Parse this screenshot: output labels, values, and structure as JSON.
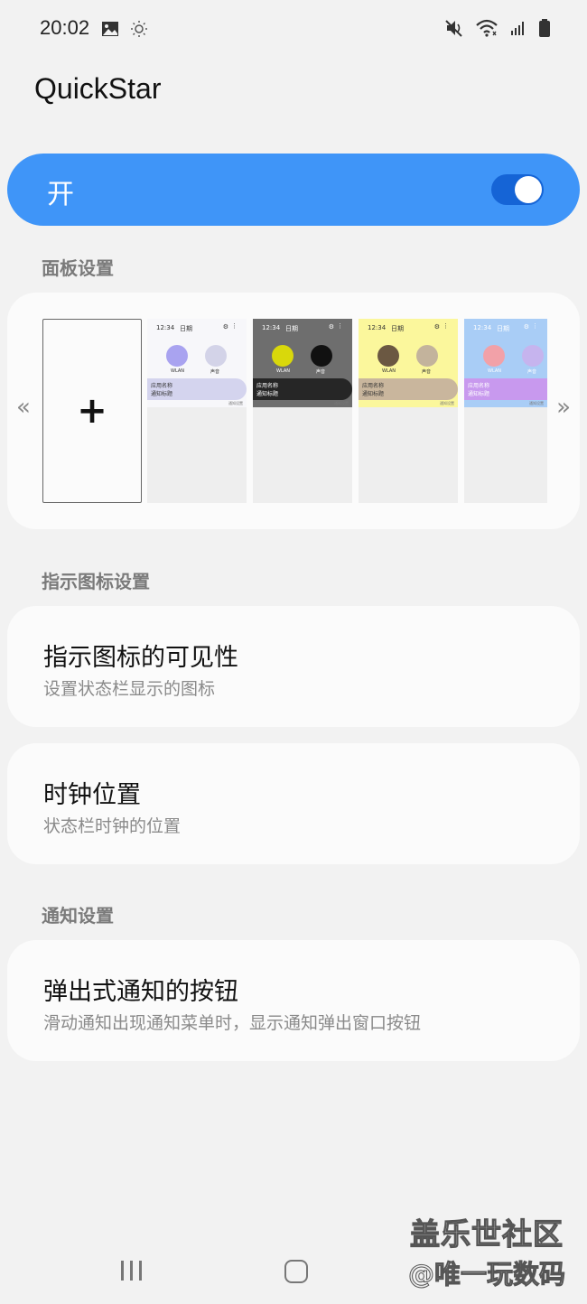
{
  "status_bar": {
    "time": "20:02",
    "left_icons": [
      "image-icon",
      "brightness-icon"
    ],
    "right_icons": [
      "mute-icon",
      "wifi-icon",
      "signal-icon",
      "battery-icon"
    ]
  },
  "app_title": "QuickStar",
  "master_switch": {
    "label": "开",
    "on": true,
    "color": "#3f95f8"
  },
  "panel_section": {
    "header": "面板设置",
    "prev_arrow": "«",
    "next_arrow": "»",
    "add_symbol": "+",
    "themes": [
      {
        "time": "12:34",
        "date": "日期",
        "wifi_label": "WLAN",
        "sound_label": "声音",
        "app_name": "应用名称",
        "notif_title": "通知标题",
        "notif_settings": "通知设置",
        "bg": "#f7f7fa",
        "wifi_color": "#a9a3f0",
        "vol_color": "#d3d3e8",
        "bar_color": "#d4d4ee",
        "text_color": "#333"
      },
      {
        "time": "12:34",
        "date": "日期",
        "wifi_label": "WLAN",
        "sound_label": "声音",
        "app_name": "应用名称",
        "notif_title": "通知标题",
        "notif_settings": "通知设置",
        "bg": "#6e6e6e",
        "wifi_color": "#d9d80b",
        "vol_color": "#111111",
        "bar_color": "#262626",
        "text_color": "#fff"
      },
      {
        "time": "12:34",
        "date": "日期",
        "wifi_label": "WLAN",
        "sound_label": "声音",
        "app_name": "应用名称",
        "notif_title": "通知标题",
        "notif_settings": "通知设置",
        "bg": "#fbf79c",
        "wifi_color": "#6b5842",
        "vol_color": "#c3b39c",
        "bar_color": "#c9b69d",
        "text_color": "#333"
      },
      {
        "time": "12:34",
        "date": "日期",
        "wifi_label": "WLAN",
        "sound_label": "声音",
        "app_name": "应用名称",
        "notif_title": "通知标题",
        "notif_settings": "通知设置",
        "bg": "#a9cdf6",
        "wifi_color": "#f2a1a8",
        "vol_color": "#c6b4ee",
        "bar_color": "#c899ee",
        "text_color": "#fff"
      }
    ]
  },
  "indicator_section": {
    "header": "指示图标设置",
    "items": [
      {
        "title": "指示图标的可见性",
        "subtitle": "设置状态栏显示的图标"
      },
      {
        "title": "时钟位置",
        "subtitle": "状态栏时钟的位置"
      }
    ]
  },
  "notification_section": {
    "header": "通知设置",
    "items": [
      {
        "title": "弹出式通知的按钮",
        "subtitle": "滑动通知出现通知菜单时，显示通知弹出窗口按钮"
      }
    ]
  },
  "watermark": {
    "line1": "盖乐世社区",
    "line2": "@唯一玩数码"
  },
  "nav_bar": [
    "recents-icon",
    "home-icon"
  ]
}
